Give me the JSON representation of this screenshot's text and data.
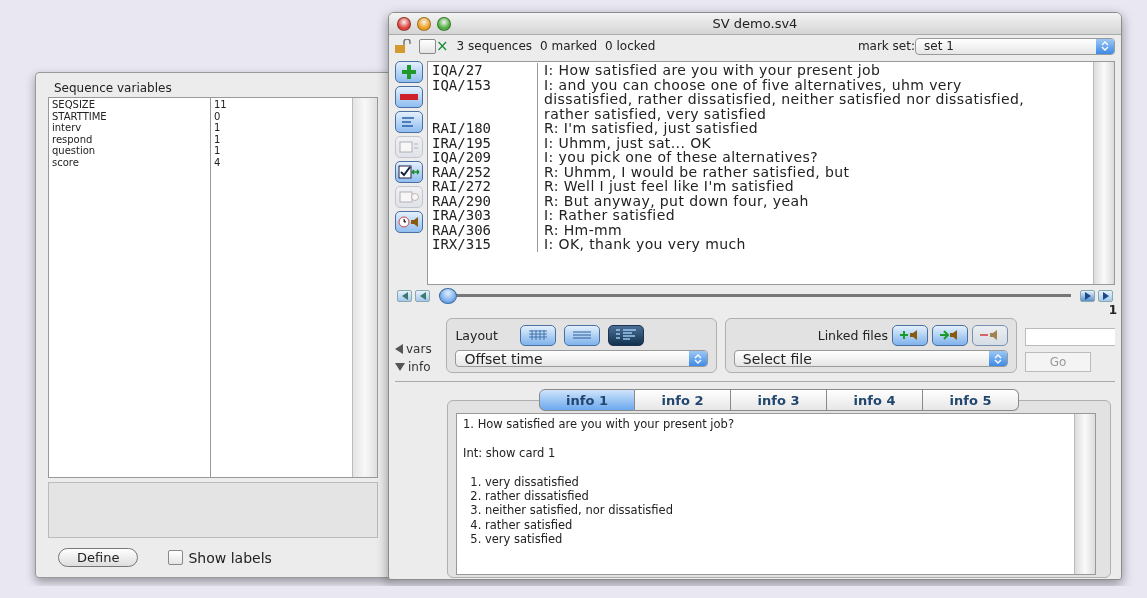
{
  "variables_panel": {
    "title": "Sequence variables",
    "rows": [
      {
        "name": "SEQSIZE",
        "value": "11"
      },
      {
        "name": "STARTTIME",
        "value": "0"
      },
      {
        "name": "interv",
        "value": "1"
      },
      {
        "name": "respond",
        "value": "1"
      },
      {
        "name": "question",
        "value": "1"
      },
      {
        "name": "score",
        "value": "4"
      }
    ],
    "define_button": "Define",
    "show_labels": {
      "label": "Show labels",
      "checked": false
    }
  },
  "window": {
    "title": "SV demo.sv4"
  },
  "toolbar": {
    "locked": false,
    "select_all": {
      "checked": false
    },
    "clear_mark": "×",
    "sequences": "3 sequences",
    "marked": "0 marked",
    "locked_count": "0 locked",
    "mark_set_label": "mark set:",
    "mark_set": "set 1"
  },
  "tools": [
    {
      "kind": "add",
      "disabled": false
    },
    {
      "kind": "remove",
      "disabled": false
    },
    {
      "kind": "text",
      "disabled": false
    },
    {
      "kind": "define",
      "disabled": true
    },
    {
      "kind": "mark",
      "disabled": false
    },
    {
      "kind": "time",
      "disabled": true
    },
    {
      "kind": "sound",
      "disabled": false
    }
  ],
  "events": [
    {
      "code": "IQA/27",
      "text": "I: How satisfied are you with your present job"
    },
    {
      "code": "IQA/153",
      "text": "I: and you can choose one of five alternatives, uhm very dissatisfied, rather dissatisfied, neither satisfied nor dissatisfied, rather satisfied, very satisfied"
    },
    {
      "code": "RAI/180",
      "text": "R: I'm satisfied, just satisfied"
    },
    {
      "code": "IRA/195",
      "text": "I: Uhmm, just sat... OK"
    },
    {
      "code": "IQA/209",
      "text": "I: you pick one of these alternatives?"
    },
    {
      "code": "RAA/252",
      "text": "R: Uhmm, I would be rather satisfied, but"
    },
    {
      "code": "RAI/272",
      "text": "R: Well I just feel like I'm satisfied"
    },
    {
      "code": "RAA/290",
      "text": "R: But anyway, put down four, yeah"
    },
    {
      "code": "IRA/303",
      "text": "I: Rather satisfied"
    },
    {
      "code": "RAA/306",
      "text": "R: Hm-mm"
    },
    {
      "code": "IRX/315",
      "text": "I: OK, thank you very much"
    }
  ],
  "position": {
    "level": 0,
    "sequence_number": "1"
  },
  "disclosures": [
    {
      "label": "vars",
      "expanded": false
    },
    {
      "label": "info",
      "expanded": true
    }
  ],
  "layout": {
    "label": "Layout",
    "buttons": [
      {
        "kind": "columns",
        "selected": false
      },
      {
        "kind": "rows",
        "selected": false
      },
      {
        "kind": "offset",
        "selected": true
      }
    ],
    "select": "Offset time"
  },
  "linked_files": {
    "label": "Linked files",
    "buttons": [
      {
        "kind": "add",
        "disabled": false
      },
      {
        "kind": "go",
        "disabled": false
      },
      {
        "kind": "remove",
        "disabled": true
      }
    ],
    "select": "Select file"
  },
  "go_button": {
    "label": "Go",
    "disabled": true
  },
  "info_tabs": [
    {
      "label": "info 1",
      "selected": true
    },
    {
      "label": "info 2",
      "selected": false
    },
    {
      "label": "info 3",
      "selected": false
    },
    {
      "label": "info 4",
      "selected": false
    },
    {
      "label": "info 5",
      "selected": false
    }
  ],
  "info_text": [
    [
      "1. How satisfied are you with your present job?"
    ],
    [
      "Int: show card 1"
    ],
    [
      "  1. very dissatisfied",
      "  2. rather dissatisfied",
      "  3. neither satisfied, nor dissatisfied",
      "  4. rather satisfied",
      "  5. very satisfied"
    ]
  ]
}
